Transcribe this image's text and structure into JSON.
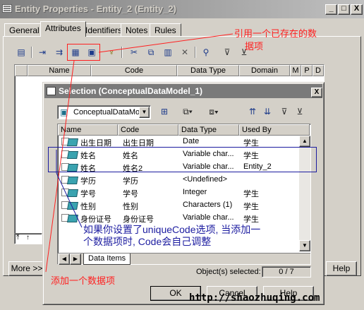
{
  "window": {
    "title": "Entity Properties - Entity_2 (Entity_2)",
    "controls": [
      "_",
      "□",
      "X"
    ]
  },
  "tabs": [
    {
      "label": "General",
      "active": false
    },
    {
      "label": "Attributes",
      "active": true
    },
    {
      "label": "Identifiers",
      "active": false
    },
    {
      "label": "Notes",
      "active": false
    },
    {
      "label": "Rules",
      "active": false
    }
  ],
  "attribute_grid": {
    "columns": [
      "Name",
      "Code",
      "Data Type",
      "Domain",
      "M",
      "P",
      "D"
    ]
  },
  "footer": {
    "more_label": "More >>",
    "help_label": "Help"
  },
  "dialog": {
    "title": "Selection (ConceptualDataModel_1)",
    "close": "X",
    "model_select": "ConceptualDataMo",
    "columns": [
      "Name",
      "Code",
      "Data Type",
      "Used By"
    ],
    "rows": [
      {
        "name": "出生日期",
        "code": "出生日期",
        "type": "Date",
        "used_by": "学生"
      },
      {
        "name": "姓名",
        "code": "姓名",
        "type": "Variable char...",
        "used_by": "学生"
      },
      {
        "name": "姓名",
        "code": "姓名2",
        "type": "Variable char...",
        "used_by": "Entity_2"
      },
      {
        "name": "学历",
        "code": "学历",
        "type": "<Undefined>",
        "used_by": ""
      },
      {
        "name": "学号",
        "code": "学号",
        "type": "Integer",
        "used_by": "学生"
      },
      {
        "name": "性别",
        "code": "性别",
        "type": "Characters (1)",
        "used_by": "学生"
      },
      {
        "name": "身份证号",
        "code": "身份证号",
        "type": "Variable char...",
        "used_by": "学生"
      }
    ],
    "bottom_tab": "Data Items",
    "status_label": "Object(s) selected:",
    "status_value": "0 / 7",
    "ok_label": "OK",
    "cancel_label": "Cancel",
    "help_label": "Help"
  },
  "annotations": {
    "top_right_line1": "引用一个已存在的数",
    "top_right_line2": "据项",
    "middle_line1": "如果你设置了uniqueCode选项, 当添加一",
    "middle_line2": "个数据项时, Code会自己调整",
    "bottom_left": "添加一个数据项",
    "watermark": "http://shaozhuqing.com"
  },
  "colors": {
    "annotation_red": "#ff2020",
    "annotation_blue": "#1c1ca0",
    "title_gray": "#7a7a7a"
  }
}
